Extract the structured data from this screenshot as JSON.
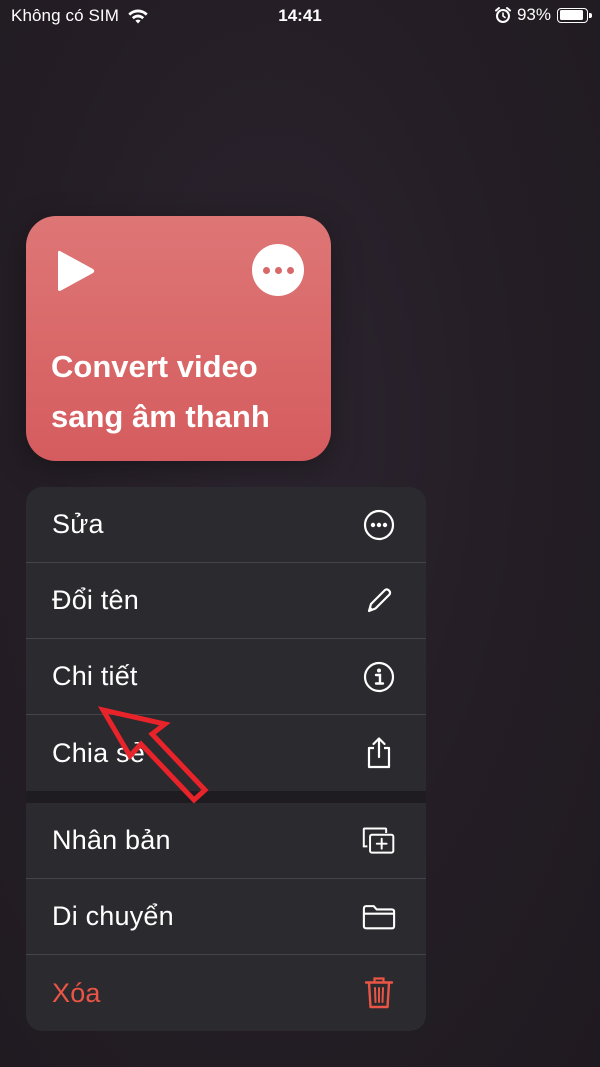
{
  "status_bar": {
    "carrier": "Không có SIM",
    "time": "14:41",
    "battery_percent": "93%",
    "battery_level": 0.93,
    "icons": [
      "wifi-icon",
      "alarm-icon",
      "battery-icon"
    ]
  },
  "shortcut": {
    "title": "Convert video\nsang âm thanh",
    "color": "#d9686a",
    "icons": [
      "play-icon",
      "more-icon"
    ]
  },
  "menu": {
    "group1": [
      {
        "label": "Sửa",
        "icon": "ellipsis-circle-icon"
      },
      {
        "label": "Đổi tên",
        "icon": "pencil-icon"
      },
      {
        "label": "Chi tiết",
        "icon": "info-circle-icon"
      },
      {
        "label": "Chia sẻ",
        "icon": "share-icon"
      }
    ],
    "group2": [
      {
        "label": "Nhân bản",
        "icon": "duplicate-icon"
      },
      {
        "label": "Di chuyển",
        "icon": "folder-icon"
      },
      {
        "label": "Xóa",
        "icon": "trash-icon",
        "destructive": true
      }
    ]
  },
  "annotation": {
    "arrow_color": "#e8232a",
    "points_to": "Chi tiết"
  }
}
